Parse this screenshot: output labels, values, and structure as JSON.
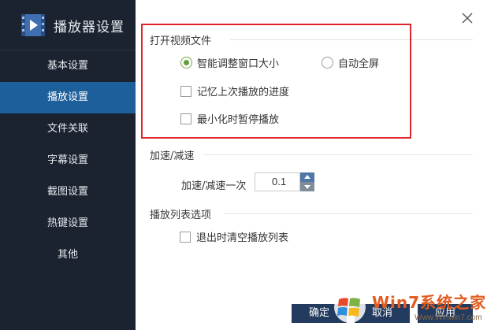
{
  "sidebar": {
    "title": "播放器设置",
    "items": [
      {
        "label": "基本设置",
        "active": false
      },
      {
        "label": "播放设置",
        "active": true
      },
      {
        "label": "文件关联",
        "active": false
      },
      {
        "label": "字幕设置",
        "active": false
      },
      {
        "label": "截图设置",
        "active": false
      },
      {
        "label": "热键设置",
        "active": false
      },
      {
        "label": "其他",
        "active": false
      }
    ]
  },
  "sections": {
    "open_file": {
      "title": "打开视频文件",
      "radio_smart_resize": {
        "label": "智能调整窗口大小",
        "checked": true
      },
      "radio_fullscreen": {
        "label": "自动全屏",
        "checked": false
      },
      "check_remember_progress": {
        "label": "记忆上次播放的进度",
        "checked": false
      },
      "check_pause_minimize": {
        "label": "最小化时暂停播放",
        "checked": false
      }
    },
    "speed": {
      "title": "加速/减速",
      "step_label": "加速/减速一次",
      "step_value": "0.1"
    },
    "playlist": {
      "title": "播放列表选项",
      "check_clear_on_exit": {
        "label": "退出时清空播放列表",
        "checked": false
      }
    }
  },
  "buttons": {
    "ok": "确定",
    "cancel": "取消",
    "apply": "应用"
  },
  "watermark": {
    "brand": "Win7系统之家",
    "url": "Www.Winwin7.com"
  },
  "colors": {
    "sidebar_bg": "#1c2330",
    "sidebar_active": "#1d5f9a",
    "highlight_border": "#e0242b",
    "radio_checked": "#5fa03a",
    "button_bg": "#223b5e"
  },
  "icons": [
    "app-logo-icon",
    "close-icon",
    "spin-up-icon",
    "spin-down-icon"
  ]
}
